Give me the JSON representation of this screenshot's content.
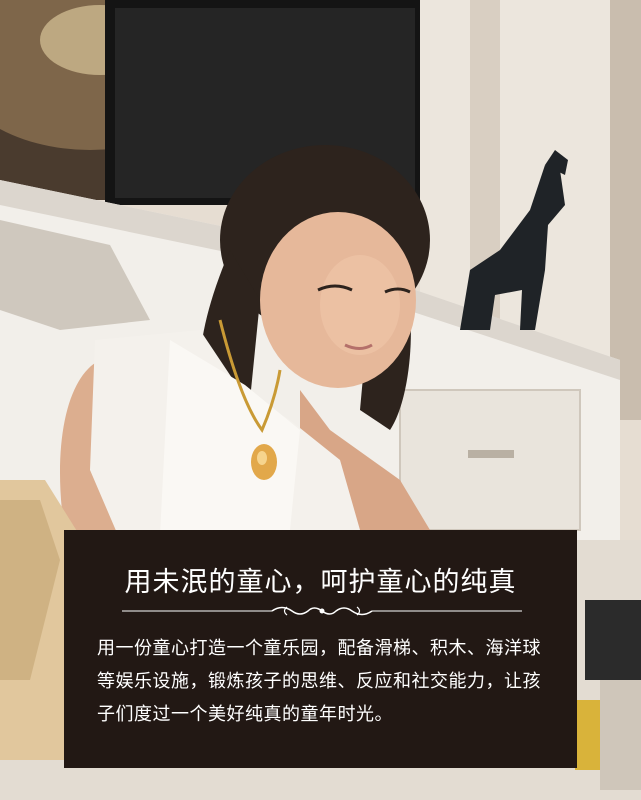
{
  "caption": {
    "title": "用未泯的童心，呵护童心的纯真",
    "body": "用一份童心打造一个童乐园，配备滑梯、积木、海洋球等娱乐设施，锻炼孩子的思维、反应和社交能力，让孩子们度过一个美好纯真的童年时光。"
  },
  "colors": {
    "caption_background": "#221814",
    "caption_text": "#ffffff"
  }
}
